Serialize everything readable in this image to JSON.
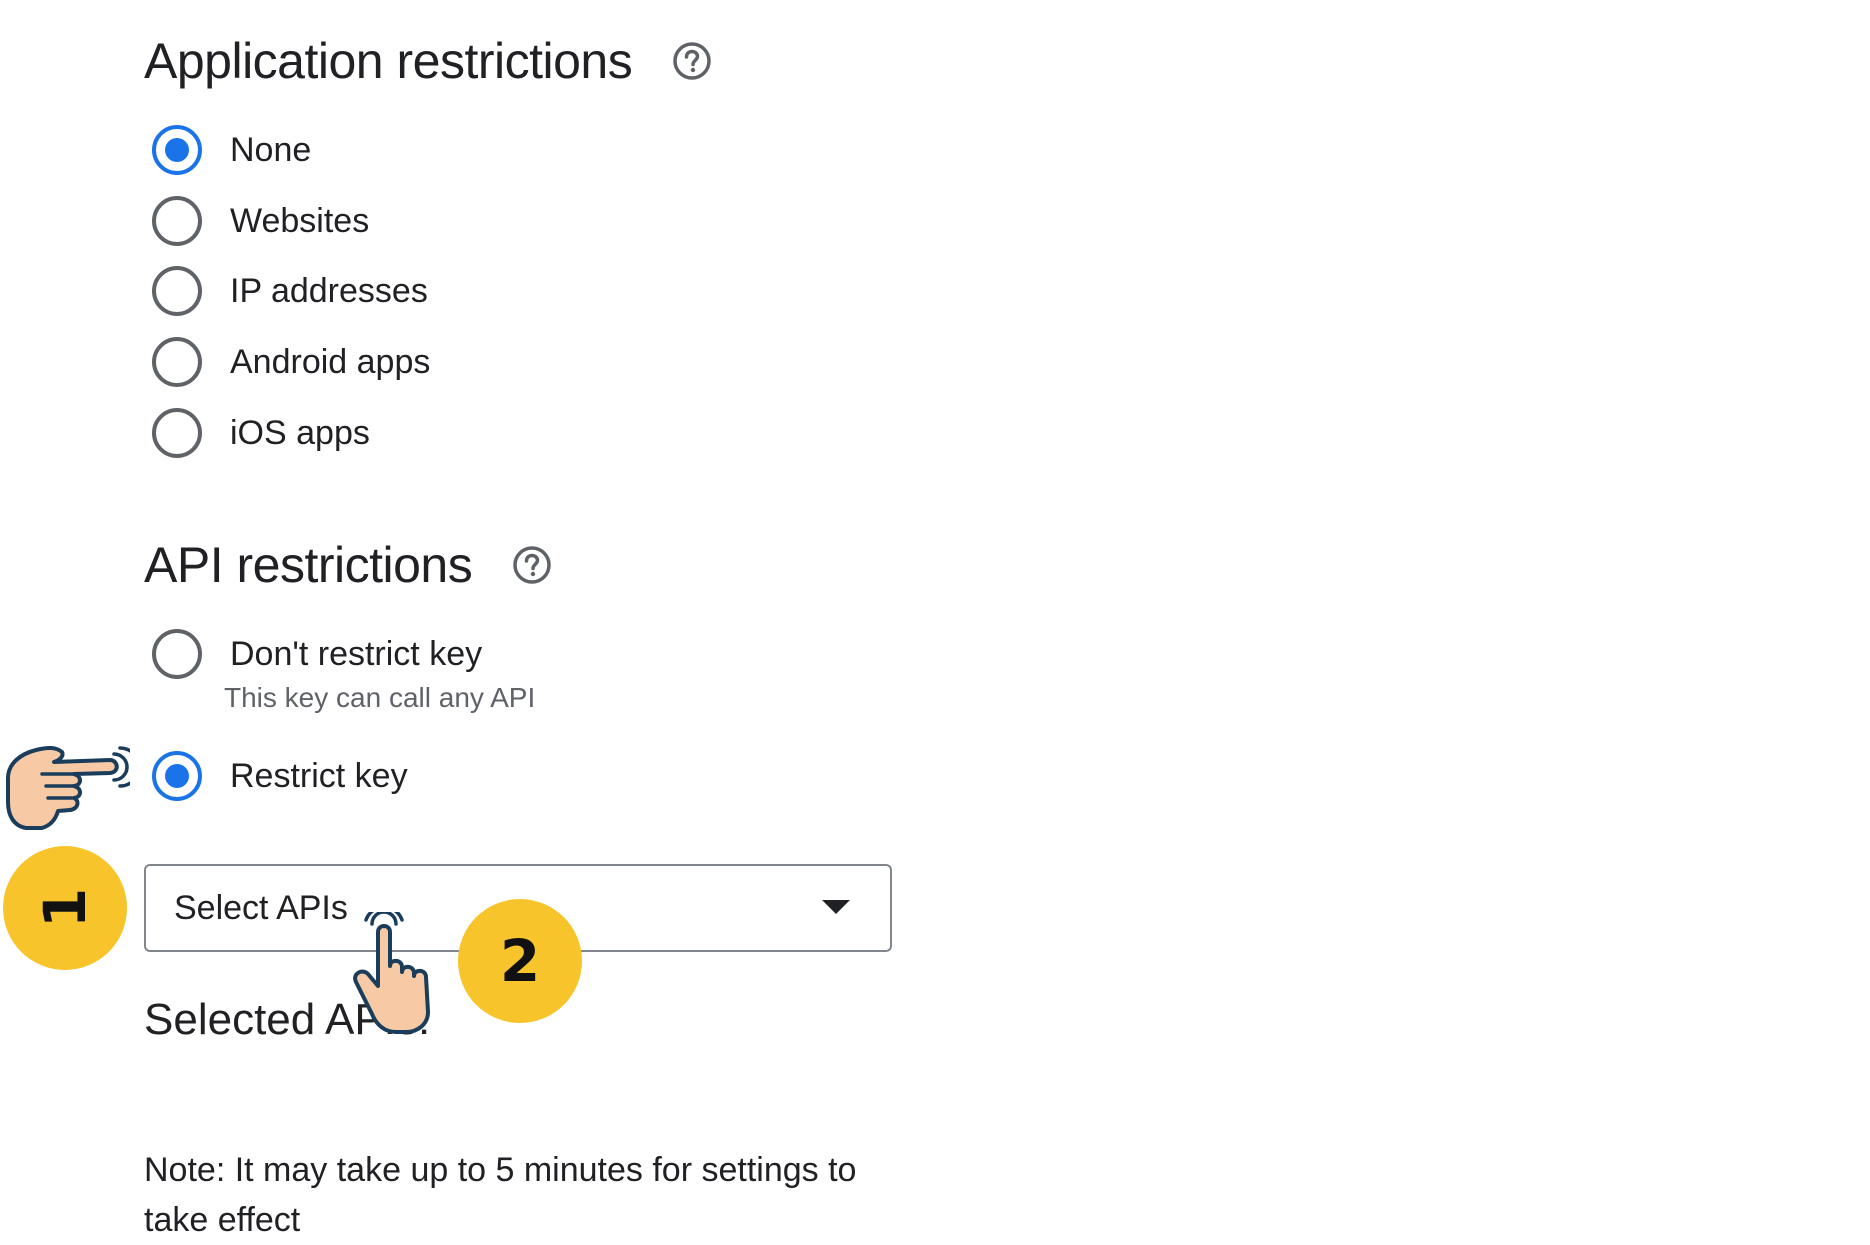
{
  "application_restrictions": {
    "title": "Application restrictions",
    "options": [
      {
        "label": "None",
        "checked": true
      },
      {
        "label": "Websites",
        "checked": false
      },
      {
        "label": "IP addresses",
        "checked": false
      },
      {
        "label": "Android apps",
        "checked": false
      },
      {
        "label": "iOS apps",
        "checked": false
      }
    ]
  },
  "api_restrictions": {
    "title": "API restrictions",
    "options": [
      {
        "label": "Don't restrict key",
        "description": "This key can call any API",
        "checked": false
      },
      {
        "label": "Restrict key",
        "checked": true
      }
    ],
    "select": {
      "value": "Select APIs"
    },
    "selected_title": "Selected APIs:"
  },
  "note": "Note: It may take up to 5 minutes for settings to take effect",
  "annotations": {
    "step_1": "1",
    "step_2": "2"
  },
  "colors": {
    "accent": "#1a73e8",
    "badge": "#f7c52b",
    "hand_fill": "#f7c9a4",
    "hand_outline": "#1b3d5c"
  }
}
